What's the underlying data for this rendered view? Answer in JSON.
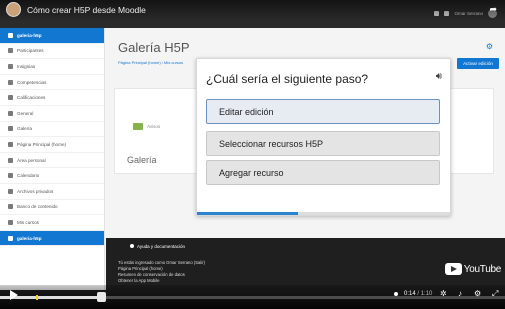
{
  "video": {
    "title": "Cómo crear H5P desde Moodle",
    "current_time": "0:14",
    "duration": "1:10",
    "progress_fraction": 0.2
  },
  "moodle": {
    "nav_user": "Omar Serrano",
    "sidebar": {
      "items": [
        {
          "label": "galeria-h5p",
          "active": true
        },
        {
          "label": "Participantes",
          "active": false
        },
        {
          "label": "Insignias",
          "active": false
        },
        {
          "label": "Competencias",
          "active": false
        },
        {
          "label": "Calificaciones",
          "active": false
        },
        {
          "label": "General",
          "active": false
        },
        {
          "label": "Galería",
          "active": false
        },
        {
          "label": "Página Principal (home)",
          "active": false
        },
        {
          "label": "Área personal",
          "active": false
        },
        {
          "label": "Calendario",
          "active": false
        },
        {
          "label": "Archivos privados",
          "active": false
        },
        {
          "label": "Banco de contenido",
          "active": false
        },
        {
          "label": "Mis cursos",
          "active": false
        },
        {
          "label": "galeria-h5p",
          "active": true
        }
      ]
    },
    "page_title": "Galería H5P",
    "breadcrumb": "Página Principal (home) / Mis cursos",
    "edit_button": "Activar edición",
    "content": {
      "section_label": "Avisos",
      "section_title": "Galería"
    },
    "footer": {
      "help": "Ayuda y documentación",
      "lines": [
        "Tú estás ingresado como Omar Serrano (Salir)",
        "Página Principal (home)",
        "Resumen de conservación de datos",
        "Obtener la App Mobile"
      ]
    }
  },
  "dialog": {
    "question": "¿Cuál sería el siguiente paso?",
    "options": [
      {
        "label": "Editar edición",
        "highlighted": true
      },
      {
        "label": "Seleccionar recursos H5P",
        "highlighted": false
      },
      {
        "label": "Agregar recurso",
        "highlighted": false
      }
    ]
  },
  "brand": {
    "youtube": "YouTube"
  },
  "colors": {
    "moodle_blue": "#1177d1",
    "dialog_progress": "#2e83cf"
  }
}
